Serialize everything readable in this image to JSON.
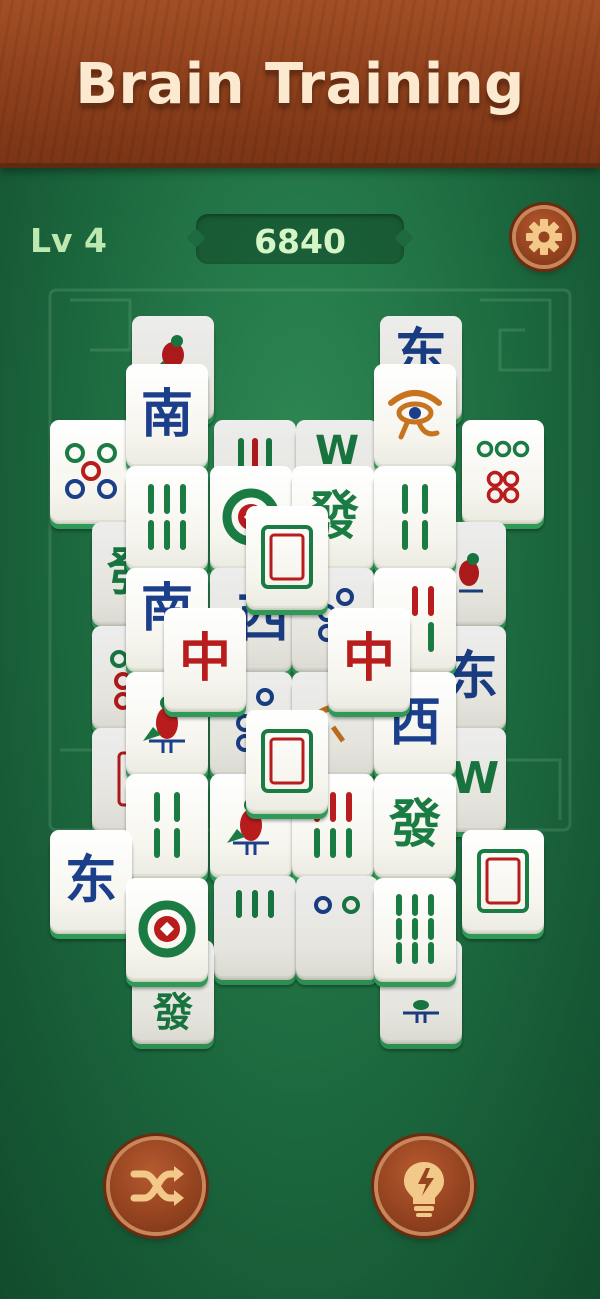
{
  "header": {
    "title": "Brain Training"
  },
  "status": {
    "level": "Lv 4",
    "score": "6840"
  },
  "colors": {
    "felt": "#1f6e42",
    "wood": "#8c3f1b",
    "tile_side": "#2f9a57",
    "blue": "#1b3f8a",
    "red": "#b81c1c",
    "green": "#1a7c43"
  },
  "icons": {
    "settings": "gear-icon",
    "shuffle": "shuffle-icon",
    "hint": "lightbulb-icon"
  },
  "tiles": [
    {
      "name": "tile-bird-top-left",
      "kind": "bird"
    },
    {
      "name": "tile-east-top-right",
      "kind": "east-wind"
    },
    {
      "name": "tile-bamboo-3-upper",
      "kind": "bamboo"
    },
    {
      "name": "tile-west-upper",
      "kind": "west-wind"
    },
    {
      "name": "tile-circles-5-left",
      "kind": "circles"
    },
    {
      "name": "tile-circles-6-right",
      "kind": "circles"
    },
    {
      "name": "tile-south-left-top",
      "kind": "south-wind",
      "glyph": "南"
    },
    {
      "name": "tile-eye-season",
      "kind": "flower"
    },
    {
      "name": "tile-green-dragon-left",
      "kind": "green-dragon",
      "glyph": "發"
    },
    {
      "name": "tile-bamboo-6-a",
      "kind": "bamboo"
    },
    {
      "name": "tile-circle-1-upper",
      "kind": "circle-one"
    },
    {
      "name": "tile-green-dragon-mid",
      "kind": "green-dragon",
      "glyph": "發"
    },
    {
      "name": "tile-bamboo-4-right",
      "kind": "bamboo"
    },
    {
      "name": "tile-bird-right",
      "kind": "bird"
    },
    {
      "name": "tile-south-left-mid",
      "kind": "south-wind",
      "glyph": "南"
    },
    {
      "name": "tile-west-mid-hidden",
      "kind": "west-wind",
      "glyph": "西"
    },
    {
      "name": "tile-circles-right-mid",
      "kind": "circles"
    },
    {
      "name": "tile-bamboo-right-mid",
      "kind": "bamboo"
    },
    {
      "name": "tile-east-right-mid",
      "kind": "east-wind",
      "glyph": "东"
    },
    {
      "name": "tile-white-dragon-top",
      "kind": "white-dragon"
    },
    {
      "name": "tile-red-dragon-left",
      "kind": "red-dragon",
      "glyph": "中"
    },
    {
      "name": "tile-red-dragon-right",
      "kind": "red-dragon",
      "glyph": "中"
    },
    {
      "name": "tile-circles-left-lower",
      "kind": "circles"
    },
    {
      "name": "tile-bird-left-lower",
      "kind": "bird"
    },
    {
      "name": "tile-white-dragon-left-edge",
      "kind": "white-dragon"
    },
    {
      "name": "tile-circles-center-lower",
      "kind": "circles"
    },
    {
      "name": "tile-eye-lower",
      "kind": "flower"
    },
    {
      "name": "tile-west-right-lower",
      "kind": "west-wind",
      "glyph": "西"
    },
    {
      "name": "tile-west-far-right",
      "kind": "west-wind"
    },
    {
      "name": "tile-white-dragon-bottom",
      "kind": "white-dragon"
    },
    {
      "name": "tile-east-bottom-left",
      "kind": "east-wind",
      "glyph": "东"
    },
    {
      "name": "tile-bamboo-4-lower-left",
      "kind": "bamboo"
    },
    {
      "name": "tile-bird-lower",
      "kind": "bird"
    },
    {
      "name": "tile-bamboo-6-lower",
      "kind": "bamboo"
    },
    {
      "name": "tile-green-dragon-lower-right",
      "kind": "green-dragon",
      "glyph": "發"
    },
    {
      "name": "tile-white-dragon-right-lower",
      "kind": "white-dragon"
    },
    {
      "name": "tile-circle-1-bottom",
      "kind": "circle-one"
    },
    {
      "name": "tile-bamboo-9-bottom",
      "kind": "bamboo"
    },
    {
      "name": "tile-green-dragon-bottom-hidden",
      "kind": "green-dragon"
    },
    {
      "name": "tile-bird-bottom-right-hidden",
      "kind": "bird"
    }
  ]
}
